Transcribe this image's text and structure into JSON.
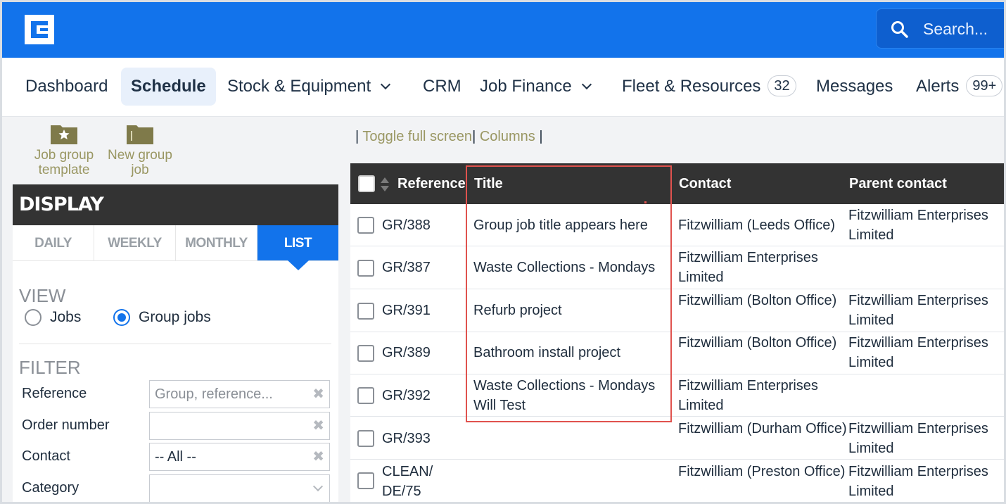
{
  "app": {
    "logo": "brand-logo",
    "search_placeholder": "Search...",
    "colors": {
      "primary": "#1273eb",
      "dark": "#333333",
      "highlight": "#e0524e",
      "link": "#9a9763"
    }
  },
  "nav": {
    "items": [
      {
        "label": "Dashboard"
      },
      {
        "label": "Schedule",
        "active": true
      },
      {
        "label": "Stock & Equipment",
        "dropdown": true
      },
      {
        "label": "CRM"
      },
      {
        "label": "Job Finance",
        "dropdown": true
      },
      {
        "label": "Fleet & Resources",
        "badge": "32"
      },
      {
        "label": "Messages"
      },
      {
        "label": "Alerts",
        "badge": "99+"
      }
    ]
  },
  "sidebar": {
    "actions": [
      {
        "line1": "Job group",
        "line2": "template",
        "icon": "folder-star-icon"
      },
      {
        "line1": "New group",
        "line2": "job",
        "icon": "folder-icon"
      }
    ],
    "display_title": "DISPLAY",
    "tabs": [
      {
        "label": "DAILY"
      },
      {
        "label": "WEEKLY"
      },
      {
        "label": "MONTHLY"
      },
      {
        "label": "LIST",
        "active": true
      }
    ],
    "view_label": "VIEW",
    "view_options": [
      {
        "label": "Jobs",
        "selected": false
      },
      {
        "label": "Group jobs",
        "selected": true
      }
    ],
    "filter_label": "FILTER",
    "filters": [
      {
        "label": "Reference",
        "value": "",
        "placeholder": "Group, reference..."
      },
      {
        "label": "Order number",
        "value": ""
      },
      {
        "label": "Contact",
        "value": "-- All --"
      },
      {
        "label": "Category",
        "value": ""
      }
    ]
  },
  "toolbar": {
    "toggle_label": "Toggle full screen",
    "columns_label": "Columns"
  },
  "table": {
    "headers": {
      "reference": "Reference",
      "title": "Title",
      "contact": "Contact",
      "parent": "Parent contact"
    },
    "rows": [
      {
        "ref": "GR/388",
        "title": "Group job title appears here",
        "contact": "Fitzwilliam (Leeds Office)",
        "parent": "Fitzwilliam Enterprises Limited"
      },
      {
        "ref": "GR/387",
        "title": "Waste Collections - Mondays",
        "contact": "Fitzwilliam Enterprises Limited",
        "parent": ""
      },
      {
        "ref": "GR/391",
        "title": "Refurb project",
        "contact": "Fitzwilliam (Bolton Office)",
        "parent": "Fitzwilliam Enterprises Limited"
      },
      {
        "ref": "GR/389",
        "title": "Bathroom install project",
        "contact": "Fitzwilliam (Bolton Office)",
        "parent": "Fitzwilliam Enterprises Limited"
      },
      {
        "ref": "GR/392",
        "title": "Waste Collections - Mondays Will Test",
        "contact": "Fitzwilliam Enterprises Limited",
        "parent": ""
      },
      {
        "ref": "GR/393",
        "title": "",
        "contact": "Fitzwilliam (Durham Office)",
        "parent": "Fitzwilliam Enterprises Limited"
      },
      {
        "ref": "CLEAN/ DE/75",
        "title": "",
        "contact": "Fitzwilliam (Preston Office)",
        "parent": "Fitzwilliam Enterprises Limited"
      }
    ]
  }
}
